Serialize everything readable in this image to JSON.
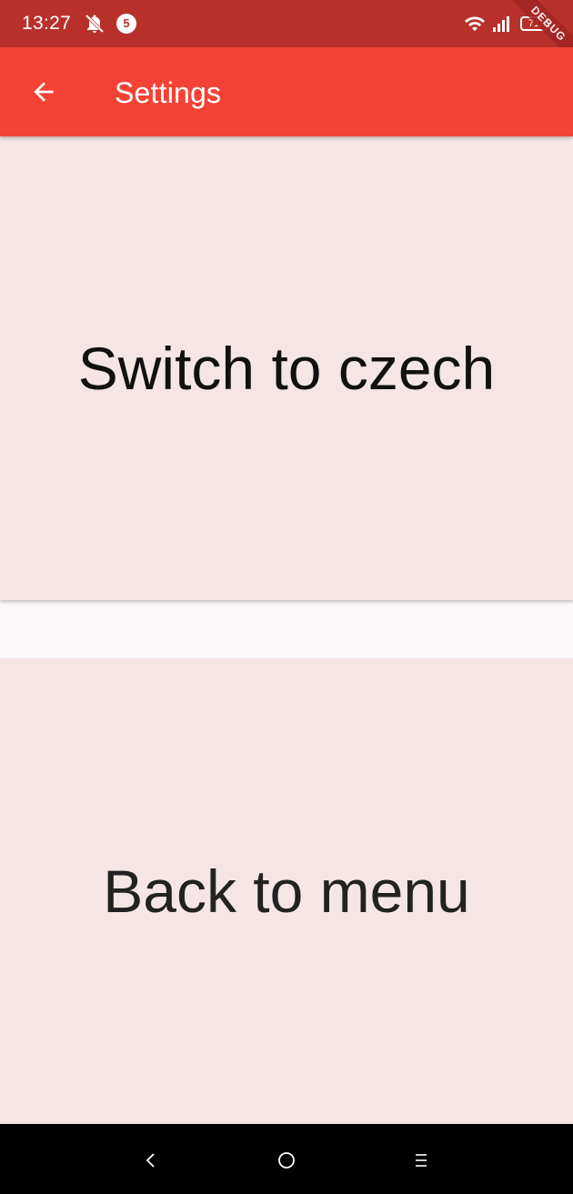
{
  "status_bar": {
    "time": "13:27",
    "notification_count": "5",
    "battery_level": "71",
    "debug_banner": "DEBUG",
    "icons": [
      "bell-off-icon",
      "message-badge-icon",
      "wifi-icon",
      "signal-icon",
      "battery-icon"
    ]
  },
  "app_bar": {
    "title": "Settings",
    "back_icon": "arrow-back-icon"
  },
  "options": {
    "switch_language": "Switch to czech",
    "back_to_menu": "Back to menu"
  },
  "nav_bar": {
    "icons": [
      "nav-back-icon",
      "nav-home-icon",
      "nav-menu-icon"
    ]
  },
  "colors": {
    "status_bar": "#b7312a",
    "app_bar": "#f44336",
    "card_background": "#f5e6e6",
    "page_background": "#faf8f9",
    "nav_bar": "#000000"
  }
}
